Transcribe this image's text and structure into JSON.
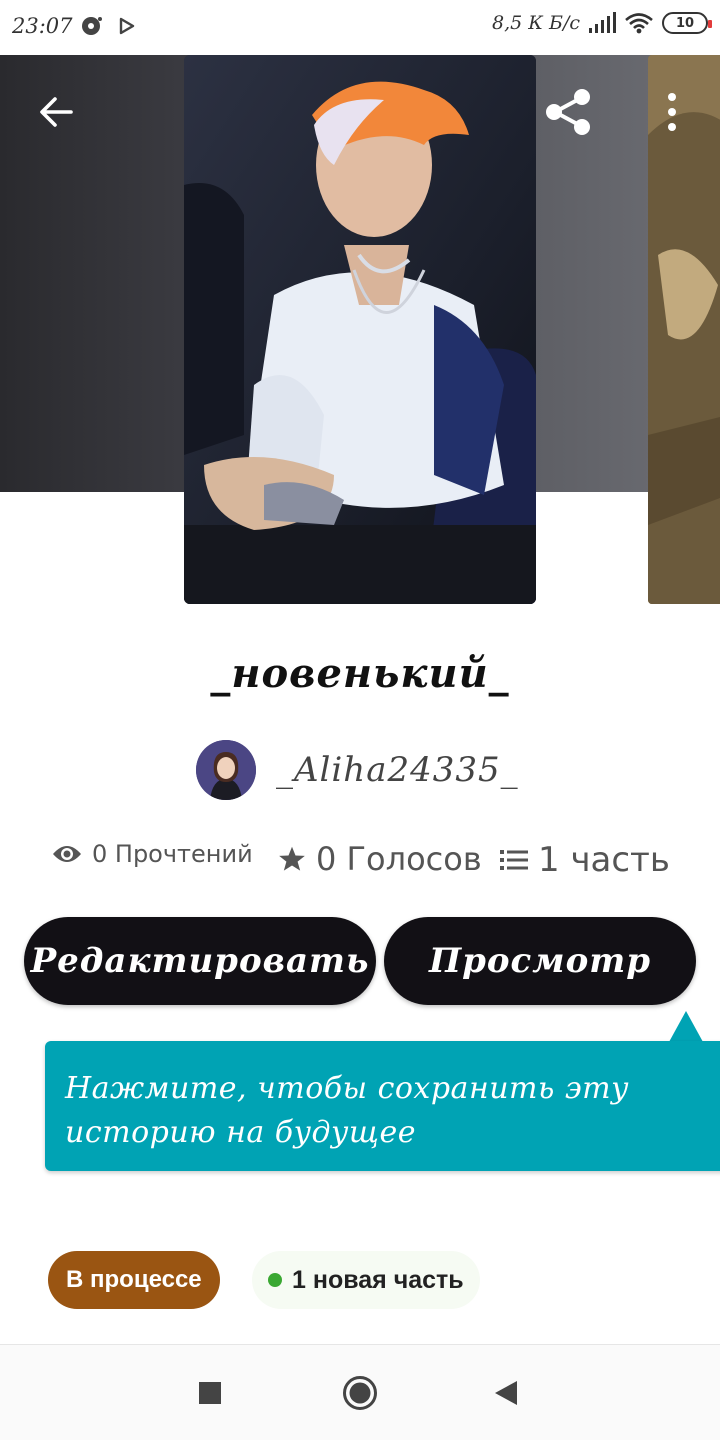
{
  "status_bar": {
    "time": "23:07",
    "net_speed": "8,5 К Б/с",
    "battery": "10"
  },
  "story": {
    "title": "_новенький_",
    "author": "_Aliha24335_",
    "stats": {
      "reads": "0 Прочтений",
      "votes": "0 Голосов",
      "parts": "1 часть"
    }
  },
  "buttons": {
    "edit_label": "Редактировать",
    "view_label": "Просмотр"
  },
  "tooltip": {
    "text": "Нажмите, чтобы сохранить эту историю на будущее"
  },
  "badges": {
    "status": "В процессе",
    "new_parts": "1 новая часть"
  },
  "colors": {
    "button_bg": "#121015",
    "tooltip_bg": "#00a3b4",
    "status_badge_bg": "#9a5512",
    "new_dot": "#3aa832"
  },
  "icons": {
    "back": "arrow-left-icon",
    "share": "share-icon",
    "more": "more-vertical-icon",
    "reads": "eye-icon",
    "votes": "star-icon",
    "parts": "list-icon",
    "nav_recent": "square-icon",
    "nav_home": "circle-icon",
    "nav_back": "triangle-back-icon"
  }
}
